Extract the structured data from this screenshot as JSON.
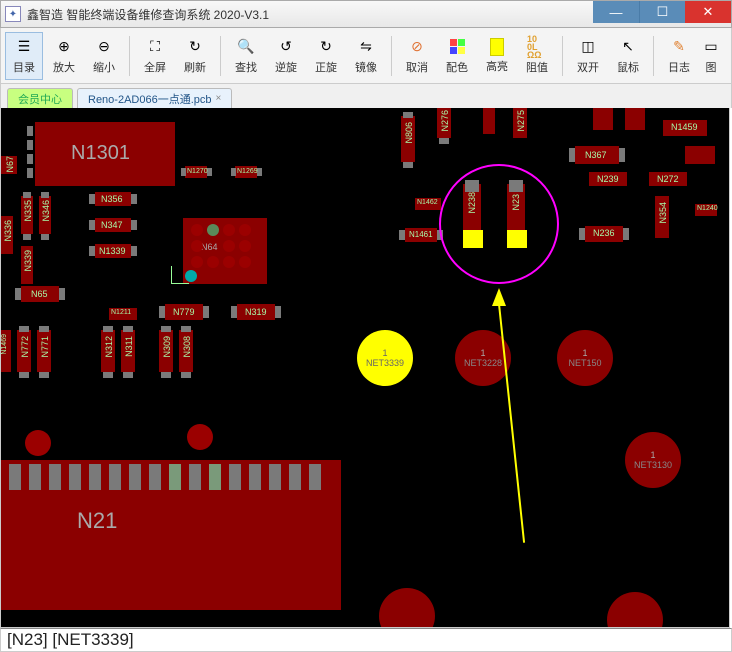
{
  "window": {
    "title": "鑫智造 智能终端设备维修查询系统 2020-V3.1"
  },
  "toolbar": [
    {
      "id": "catalog",
      "label": "目录"
    },
    {
      "id": "zoomin",
      "label": "放大"
    },
    {
      "id": "zoomout",
      "label": "缩小"
    },
    {
      "id": "sep"
    },
    {
      "id": "fullscreen",
      "label": "全屏"
    },
    {
      "id": "refresh",
      "label": "刷新"
    },
    {
      "id": "sep"
    },
    {
      "id": "search",
      "label": "查找"
    },
    {
      "id": "ccw",
      "label": "逆旋"
    },
    {
      "id": "cw",
      "label": "正旋"
    },
    {
      "id": "mirror",
      "label": "镜像"
    },
    {
      "id": "sep"
    },
    {
      "id": "cancel",
      "label": "取消"
    },
    {
      "id": "palette",
      "label": "配色"
    },
    {
      "id": "highlight",
      "label": "高亮"
    },
    {
      "id": "resist",
      "label": "阻值"
    },
    {
      "id": "sep"
    },
    {
      "id": "dual",
      "label": "双开"
    },
    {
      "id": "cursor",
      "label": "鼠标"
    },
    {
      "id": "sep"
    },
    {
      "id": "log",
      "label": "日志"
    },
    {
      "id": "pic",
      "label": "图"
    }
  ],
  "tabs": {
    "member": "会员中心",
    "file": "Reno-2AD066一点通.pcb"
  },
  "pcb": {
    "big_label": "N1301",
    "bottom_label": "N21",
    "refs": {
      "n67": "N67",
      "n335": "N335",
      "n336": "N336",
      "n346": "N346",
      "n339": "N339",
      "n65": "N65",
      "n356": "N356",
      "n347": "N347",
      "n1339": "N1339",
      "n64": "N64",
      "n1211": "N1211",
      "n779": "N779",
      "n319": "N319",
      "n772": "N772",
      "n771": "N771",
      "n312": "N312",
      "n311": "N311",
      "n309": "N309",
      "n308": "N308",
      "n806": "N806",
      "n276": "N276",
      "n1462": "N1462",
      "n1461": "N1461",
      "n238": "N238",
      "n23": "N23",
      "n275": "N275",
      "n236": "N236",
      "n367": "N367",
      "n354": "N354",
      "n272": "N272",
      "n239": "N239",
      "n1459": "N1459",
      "n1270": "N1270",
      "n1269": "N1269",
      "n1469": "N1469",
      "n1240": "N1240"
    },
    "circles": {
      "y1": {
        "n": "1",
        "net": "NET3339"
      },
      "r1": {
        "n": "1",
        "net": "NET3228"
      },
      "r2": {
        "n": "1",
        "net": "NET150"
      },
      "r3": {
        "n": "1",
        "net": "NET3130"
      }
    }
  },
  "status": "[N23] [NET3339]"
}
